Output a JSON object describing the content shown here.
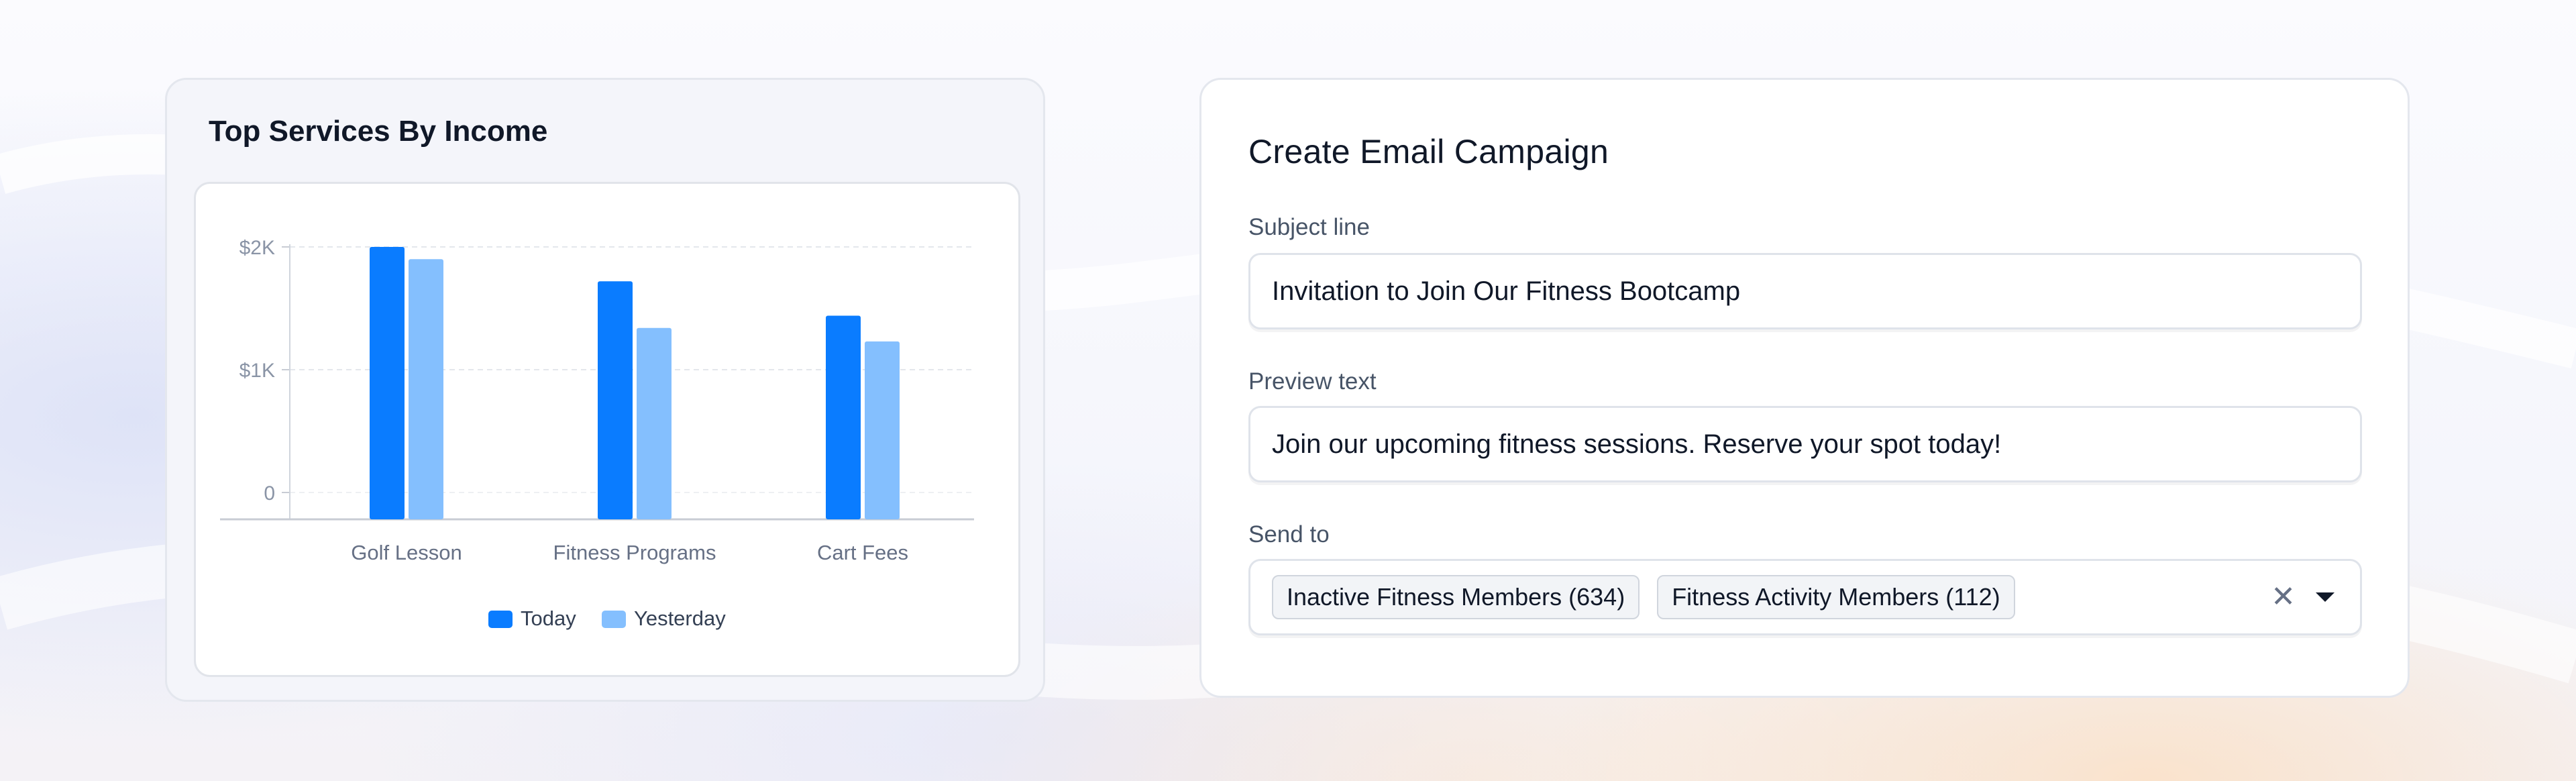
{
  "chart_card": {
    "title": "Top Services By Income"
  },
  "chart_data": {
    "type": "bar",
    "title": "Top Services By Income",
    "categories": [
      "Golf Lesson",
      "Fitness Programs",
      "Cart Fees"
    ],
    "series": [
      {
        "name": "Today",
        "values": [
          2000,
          1720,
          1440
        ],
        "color": "#0a7cff"
      },
      {
        "name": "Yesterday",
        "values": [
          1900,
          1340,
          1230
        ],
        "color": "#84bffe"
      }
    ],
    "yticks": [
      {
        "value": 0,
        "label": "0"
      },
      {
        "value": 1000,
        "label": "$1K"
      },
      {
        "value": 2000,
        "label": "$2K"
      }
    ],
    "ylim": [
      0,
      2000
    ],
    "grid": true,
    "legend_position": "bottom"
  },
  "email_form": {
    "title": "Create Email Campaign",
    "subject_label": "Subject line",
    "subject_value": "Invitation to Join Our Fitness Bootcamp",
    "preview_label": "Preview text",
    "preview_value": "Join our upcoming fitness sessions. Reserve your spot today!",
    "send_to_label": "Send to",
    "send_to_chips": [
      "Inactive Fitness Members (634)",
      "Fitness Activity Members (112)"
    ],
    "clear_symbol": "✕"
  },
  "colors": {
    "today": "#0a7cff",
    "yesterday": "#84bffe",
    "text_primary": "#101828",
    "text_secondary": "#475467"
  }
}
